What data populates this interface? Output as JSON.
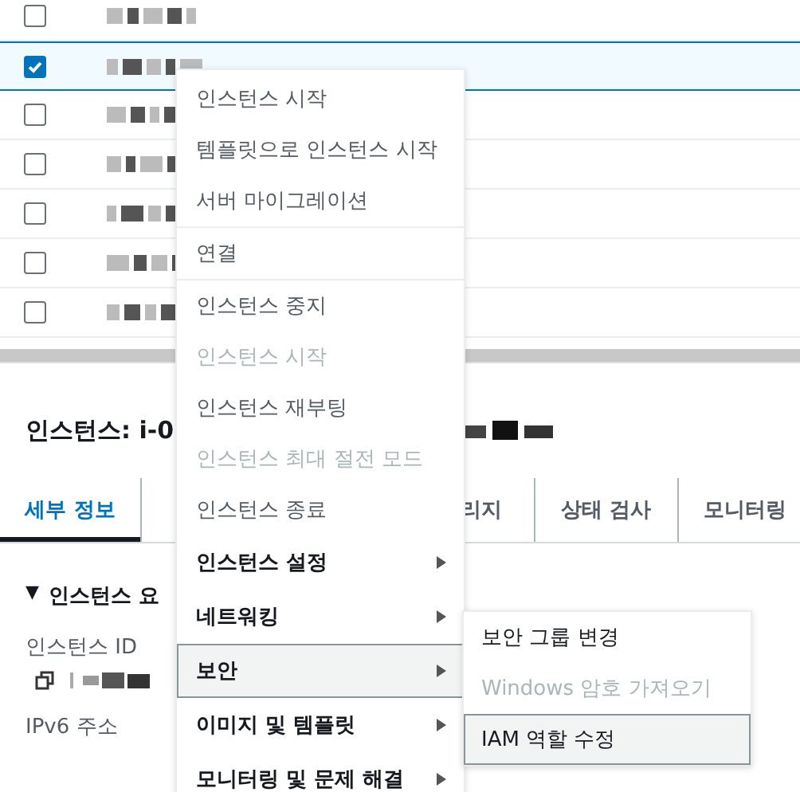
{
  "instance_rows": [
    {
      "selected": false
    },
    {
      "selected": true
    },
    {
      "selected": false
    },
    {
      "selected": false
    },
    {
      "selected": false
    },
    {
      "selected": false
    },
    {
      "selected": false
    }
  ],
  "detail_panel": {
    "title": "인스턴스: i-0",
    "tabs": [
      {
        "label": "세부 정보",
        "selected": true
      },
      {
        "label": "리지",
        "selected": false
      },
      {
        "label": "상태 검사",
        "selected": false
      },
      {
        "label": "모니터링",
        "selected": false
      }
    ],
    "section_toggle": "▼",
    "section_title": "인스턴스 요",
    "fields": [
      {
        "label": "인스턴스 ID",
        "redacted": true
      },
      {
        "label": "IPv6 주소",
        "redacted": false
      }
    ]
  },
  "context_menu": {
    "groups": [
      [
        {
          "label": "인스턴스 시작",
          "disabled": false,
          "has_submenu": false,
          "selected": false
        },
        {
          "label": "템플릿으로 인스턴스 시작",
          "disabled": false,
          "has_submenu": false,
          "selected": false
        },
        {
          "label": "서버 마이그레이션",
          "disabled": false,
          "has_submenu": false,
          "selected": false
        }
      ],
      [
        {
          "label": "연결",
          "disabled": false,
          "has_submenu": false,
          "selected": false
        }
      ],
      [
        {
          "label": "인스턴스 중지",
          "disabled": false,
          "has_submenu": false,
          "selected": false
        },
        {
          "label": "인스턴스 시작",
          "disabled": true,
          "has_submenu": false,
          "selected": false
        },
        {
          "label": "인스턴스 재부팅",
          "disabled": false,
          "has_submenu": false,
          "selected": false
        },
        {
          "label": "인스턴스 최대 절전 모드",
          "disabled": true,
          "has_submenu": false,
          "selected": false
        },
        {
          "label": "인스턴스 종료",
          "disabled": false,
          "has_submenu": false,
          "selected": false
        },
        {
          "label": "인스턴스 설정",
          "disabled": false,
          "has_submenu": true,
          "selected": false
        },
        {
          "label": "네트워킹",
          "disabled": false,
          "has_submenu": true,
          "selected": false
        },
        {
          "label": "보안",
          "disabled": false,
          "has_submenu": true,
          "selected": true
        },
        {
          "label": "이미지 및 템플릿",
          "disabled": false,
          "has_submenu": true,
          "selected": false
        },
        {
          "label": "모니터링 및 문제 해결",
          "disabled": false,
          "has_submenu": true,
          "selected": false
        }
      ]
    ]
  },
  "submenu": {
    "items": [
      {
        "label": "보안 그룹 변경",
        "disabled": false,
        "selected": false
      },
      {
        "label": "Windows 암호 가져오기",
        "disabled": true,
        "selected": false
      },
      {
        "label": "IAM 역할 수정",
        "disabled": false,
        "selected": true
      }
    ]
  }
}
